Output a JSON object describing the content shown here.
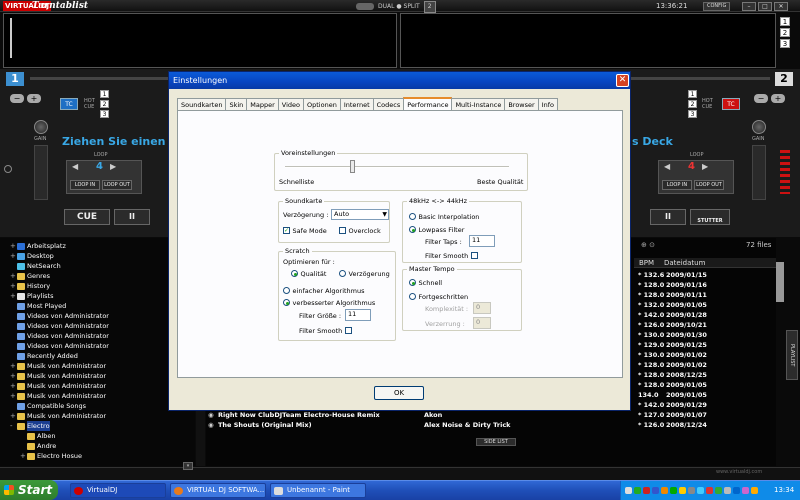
{
  "app": {
    "logo": "VIRTUAL DJ",
    "title": "Turntablist",
    "mode_label": "DUAL ● SPLIT",
    "mode_number": "2",
    "clock": "13:36:21",
    "config_label": "CONFIG"
  },
  "decks": {
    "left": {
      "number": "1",
      "cue_label": "CUE",
      "pause_symbol": "II",
      "loop_label": "LOOP",
      "loop_value": "4",
      "loop_in": "LOOP IN",
      "loop_out": "LOOP OUT",
      "gain_label": "GAIN",
      "tc_label": "TC",
      "hot_cue_label": "HOT CUE",
      "hot_cues": [
        "1",
        "2",
        "3"
      ],
      "hint_text": "Ziehen Sie einen Trac"
    },
    "right": {
      "number": "2",
      "pause_symbol": "II",
      "stutter_label": "STUTTER",
      "loop_label": "LOOP",
      "loop_value": "4",
      "loop_in": "LOOP IN",
      "loop_out": "LOOP OUT",
      "gain_label": "GAIN",
      "tc_label": "TC",
      "hot_cue_label": "HOT CUE",
      "hot_cues": [
        "1",
        "2",
        "3"
      ],
      "hint_text": "s Deck"
    },
    "top_right_numbers": [
      "1",
      "2",
      "3"
    ]
  },
  "browser": {
    "tree": [
      {
        "label": "Arbeitsplatz",
        "expand": "+",
        "color": "#2b6fd6",
        "sel": false,
        "indent": 0
      },
      {
        "label": "Desktop",
        "expand": "+",
        "color": "#4aa3e6",
        "sel": false,
        "indent": 0
      },
      {
        "label": "NetSearch",
        "expand": "",
        "color": "#4ec1e8",
        "sel": false,
        "indent": 0
      },
      {
        "label": "Genres",
        "expand": "+",
        "color": "#e8c24a",
        "sel": false,
        "indent": 0
      },
      {
        "label": "History",
        "expand": "+",
        "color": "#e8c24a",
        "sel": false,
        "indent": 0
      },
      {
        "label": "Playlists",
        "expand": "+",
        "color": "#e8e8e8",
        "sel": false,
        "indent": 0
      },
      {
        "label": "Most Played",
        "expand": "",
        "color": "#6fa0e6",
        "sel": false,
        "indent": 0
      },
      {
        "label": "Videos von Administrator",
        "expand": "",
        "color": "#6fa0e6",
        "sel": false,
        "indent": 0
      },
      {
        "label": "Videos von Administrator",
        "expand": "",
        "color": "#6fa0e6",
        "sel": false,
        "indent": 0
      },
      {
        "label": "Videos von Administrator",
        "expand": "",
        "color": "#6fa0e6",
        "sel": false,
        "indent": 0
      },
      {
        "label": "Videos von Administrator",
        "expand": "",
        "color": "#6fa0e6",
        "sel": false,
        "indent": 0
      },
      {
        "label": "Recently Added",
        "expand": "",
        "color": "#6fa0e6",
        "sel": false,
        "indent": 0
      },
      {
        "label": "Musik von Administrator",
        "expand": "+",
        "color": "#e8c24a",
        "sel": false,
        "indent": 0
      },
      {
        "label": "Musik von Administrator",
        "expand": "+",
        "color": "#e8c24a",
        "sel": false,
        "indent": 0
      },
      {
        "label": "Musik von Administrator",
        "expand": "+",
        "color": "#e8c24a",
        "sel": false,
        "indent": 0
      },
      {
        "label": "Musik von Administrator",
        "expand": "+",
        "color": "#e8c24a",
        "sel": false,
        "indent": 0
      },
      {
        "label": "Compatible Songs",
        "expand": "",
        "color": "#6fa0e6",
        "sel": false,
        "indent": 0
      },
      {
        "label": "Musik von Administrator",
        "expand": "+",
        "color": "#e8c24a",
        "sel": false,
        "indent": 0
      },
      {
        "label": "Electro",
        "expand": "-",
        "color": "#e8c24a",
        "sel": true,
        "indent": 0
      },
      {
        "label": "Alben",
        "expand": "",
        "color": "#e8c24a",
        "sel": false,
        "indent": 1
      },
      {
        "label": "Andre",
        "expand": "",
        "color": "#e8c24a",
        "sel": false,
        "indent": 1
      },
      {
        "label": "Electro Hosue",
        "expand": "+",
        "color": "#e8c24a",
        "sel": false,
        "indent": 1
      }
    ],
    "file_count": "72 files",
    "columns": {
      "bpm": "BPM",
      "date": "Dateidatum"
    },
    "rows": [
      {
        "title": "",
        "artist": "",
        "bpm": "* 132.6",
        "date": "2009/01/15"
      },
      {
        "title": "",
        "artist": "",
        "bpm": "* 128.0",
        "date": "2009/01/16"
      },
      {
        "title": "",
        "artist": "",
        "bpm": "* 128.0",
        "date": "2009/01/11"
      },
      {
        "title": "",
        "artist": "",
        "bpm": "* 132.0",
        "date": "2009/01/05"
      },
      {
        "title": "",
        "artist": "",
        "bpm": "* 142.0",
        "date": "2009/01/28"
      },
      {
        "title": "",
        "artist": "",
        "bpm": "* 126.0",
        "date": "2009/10/21"
      },
      {
        "title": "",
        "artist": "",
        "bpm": "* 130.0",
        "date": "2009/01/30"
      },
      {
        "title": "",
        "artist": "",
        "bpm": "* 129.0",
        "date": "2009/01/25"
      },
      {
        "title": "",
        "artist": "",
        "bpm": "* 130.0",
        "date": "2009/01/02"
      },
      {
        "title": "",
        "artist": "",
        "bpm": "* 128.0",
        "date": "2009/01/02"
      },
      {
        "title": "",
        "artist": "",
        "bpm": "* 128.0",
        "date": "2008/12/25"
      },
      {
        "title": "",
        "artist": "",
        "bpm": "* 128.0",
        "date": "2009/01/05"
      },
      {
        "title": "",
        "artist": "",
        "bpm": "134.0",
        "date": "2009/01/05"
      },
      {
        "title": "",
        "artist": "",
        "bpm": "* 142.0",
        "date": "2009/01/29"
      },
      {
        "title": "Right Now ClubDJTeam Electro-House Remix",
        "artist": "Akon",
        "bpm": "* 127.0",
        "date": "2009/01/07"
      },
      {
        "title": "The Shouts (Original Mix)",
        "artist": "Alex Noise & Dirty Trick",
        "bpm": "* 126.0",
        "date": "2008/12/24"
      }
    ],
    "side_list_label": "SIDE LIST",
    "playlist_label": "PLAYLIST",
    "brand_footer": "www.virtualdj.com"
  },
  "dialog": {
    "title": "Einstellungen",
    "close_symbol": "✕",
    "tabs": [
      "Soundkarten",
      "Skin",
      "Mapper",
      "Video",
      "Optionen",
      "Internet",
      "Codecs",
      "Performance",
      "Multi-Instance",
      "Browser",
      "Info"
    ],
    "active_tab": "Performance",
    "presets": {
      "group_label": "Voreinstellungen",
      "left_label": "Schnelliste",
      "right_label": "Beste Qualität",
      "level": 0.3
    },
    "soundcard": {
      "group_label": "Soundkarte",
      "delay_label": "Verzögerung :",
      "delay_value": "Auto",
      "safe_mode_label": "Safe Mode",
      "safe_mode_checked": "✓",
      "overclock_label": "Overclock"
    },
    "scratch": {
      "group_label": "Scratch",
      "optimize_label": "Optimieren für :",
      "quality_label": "Qualität",
      "delay_label": "Verzögerung",
      "simple_algo_label": "einfacher Algorithmus",
      "improved_algo_label": "verbesserter Algorithmus",
      "filter_size_label": "Filter Größe :",
      "filter_size_value": "11",
      "filter_smooth_label": "Filter Smooth"
    },
    "resample": {
      "group_label": "48kHz <-> 44kHz",
      "basic_label": "Basic Interpolation",
      "lowpass_label": "Lowpass Filter",
      "filter_taps_label": "Filter Taps :",
      "filter_taps_value": "11",
      "filter_smooth_label": "Filter Smooth"
    },
    "master_tempo": {
      "group_label": "Master Tempo",
      "fast_label": "Schnell",
      "advanced_label": "Fortgeschritten",
      "complexity_label": "Komplexität :",
      "complexity_value": "0",
      "distortion_label": "Verzerrung :",
      "distortion_value": "0"
    },
    "ok_label": "OK"
  },
  "taskbar": {
    "start_label": "Start",
    "tasks": [
      "VirtualDJ",
      "VIRTUAL DJ SOFTWA...",
      "Unbenannt - Paint"
    ],
    "clock": "13:34"
  }
}
